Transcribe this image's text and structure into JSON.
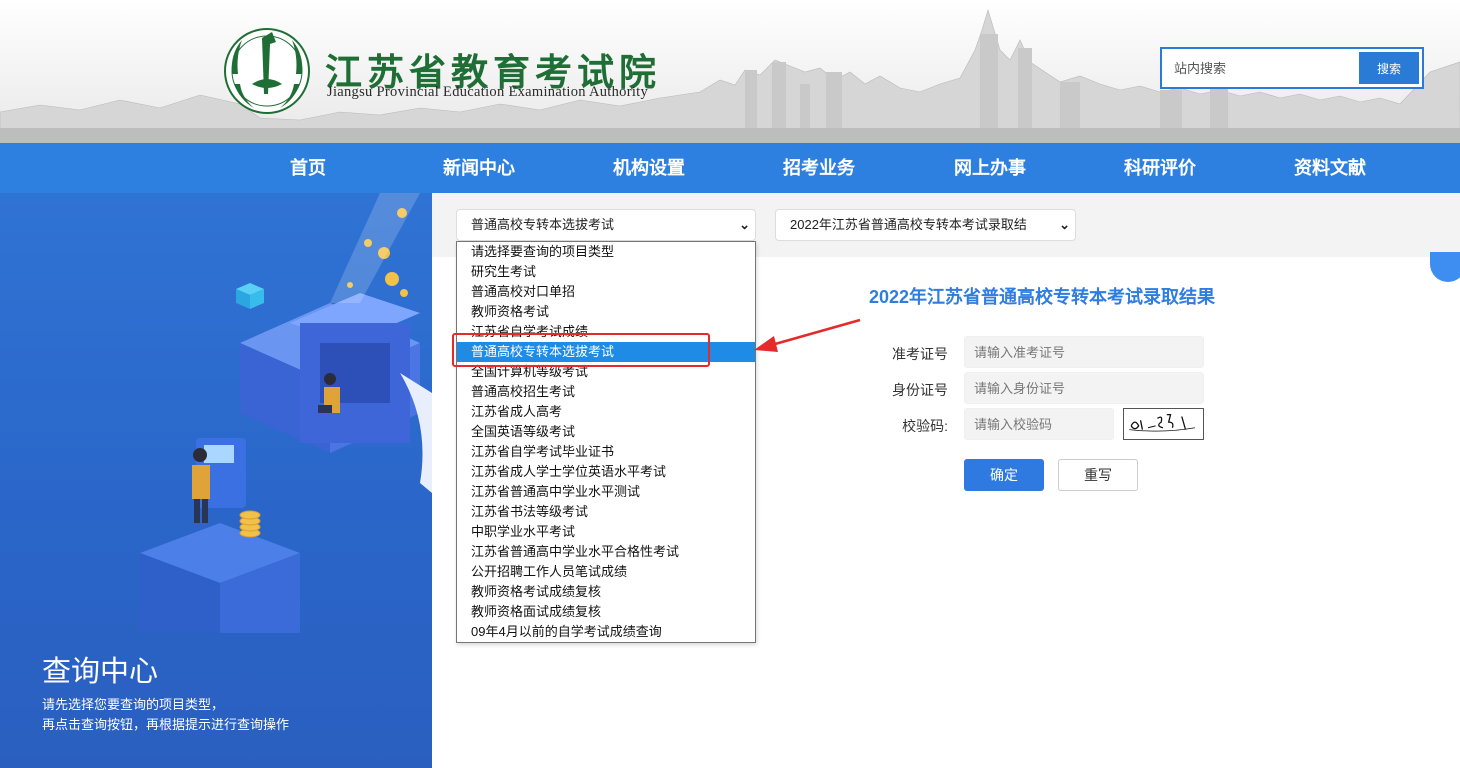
{
  "header": {
    "title_cn": "江苏省教育考试院",
    "title_en": "Jiangsu Provincial Education Examination Authority",
    "search": {
      "placeholder": "站内搜索",
      "button": "搜索"
    }
  },
  "nav": {
    "items": [
      "首页",
      "新闻中心",
      "机构设置",
      "招考业务",
      "网上办事",
      "科研评价",
      "资料文献"
    ]
  },
  "left_panel": {
    "title": "查询中心",
    "desc_line1": "请先选择您要查询的项目类型，",
    "desc_line2": "再点击查询按钮，再根据提示进行查询操作"
  },
  "filters": {
    "category_selected": "普通高校专转本选拔考试",
    "project_selected": "2022年江苏省普通高校专转本考试录取结"
  },
  "dropdown": {
    "options": [
      "请选择要查询的项目类型",
      "研究生考试",
      "普通高校对口单招",
      "教师资格考试",
      "江苏省自学考试成绩",
      "普通高校专转本选拔考试",
      "全国计算机等级考试",
      "普通高校招生考试",
      "江苏省成人高考",
      "全国英语等级考试",
      "江苏省自学考试毕业证书",
      "江苏省成人学士学位英语水平考试",
      "江苏省普通高中学业水平测试",
      "江苏省书法等级考试",
      "中职学业水平考试",
      "江苏省普通高中学业水平合格性考试",
      "公开招聘工作人员笔试成绩",
      "教师资格考试成绩复核",
      "教师资格面试成绩复核",
      "09年4月以前的自学考试成绩查询"
    ],
    "selected_index": 5
  },
  "form": {
    "title": "2022年江苏省普通高校专转本考试录取结果",
    "ticket_label": "准考证号",
    "ticket_placeholder": "请输入准考证号",
    "id_label": "身份证号",
    "id_placeholder": "请输入身份证号",
    "code_label": "校验码:",
    "code_placeholder": "请输入校验码",
    "submit": "确定",
    "reset": "重写"
  },
  "colors": {
    "nav_blue": "#2e80e0",
    "logo_green": "#1f6e35",
    "highlight_red": "#e42a2a",
    "selected_blue": "#1e8ce6"
  }
}
